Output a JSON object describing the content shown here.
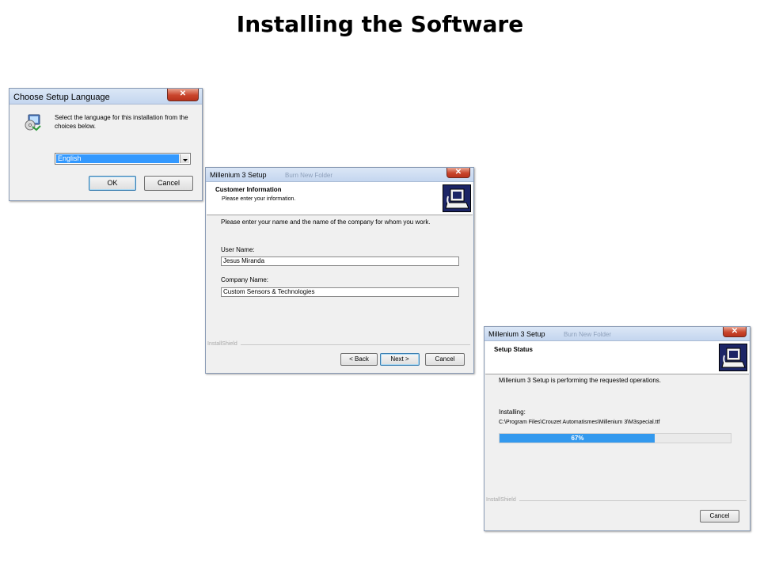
{
  "slide": {
    "title": "Installing the Software"
  },
  "language_dialog": {
    "title": "Choose Setup Language",
    "close_glyph": "✕",
    "ghost_text": "",
    "instruction": "Select the language for this installation from the choices below.",
    "selected_language": "English",
    "ok_label": "OK",
    "cancel_label": "Cancel"
  },
  "customer_dialog": {
    "title": "Millenium 3 Setup",
    "close_glyph": "✕",
    "ghost_text": "Burn     New Folder",
    "header_title": "Customer Information",
    "header_subtitle": "Please enter your information.",
    "prompt": "Please enter your name and the name of the company for whom you work.",
    "user_name_label": "User Name:",
    "user_name_value": "Jesus Miranda",
    "company_name_label": "Company Name:",
    "company_name_value": "Custom Sensors & Technologies",
    "installshield": "InstallShield",
    "back_label": "< Back",
    "next_label": "Next >",
    "cancel_label": "Cancel"
  },
  "status_dialog": {
    "title": "Millenium 3 Setup",
    "close_glyph": "✕",
    "ghost_text": "Burn     New Folder",
    "header_title": "Setup Status",
    "message": "Millenium 3 Setup is performing the requested operations.",
    "installing_label": "Installing:",
    "installing_path": "C:\\Program Files\\Crouzet Automatismes\\Millenium 3\\M3special.ttf",
    "progress_percent": 67,
    "progress_text": "67%",
    "installshield": "InstallShield",
    "cancel_label": "Cancel"
  },
  "colors": {
    "progress_fill": "#3399ee",
    "selection": "#3399ff",
    "logo_bg": "#1c2566"
  },
  "icons": [
    "setup-cd-icon",
    "dropdown-arrow-icon",
    "computer-logo-icon",
    "close-icon"
  ]
}
